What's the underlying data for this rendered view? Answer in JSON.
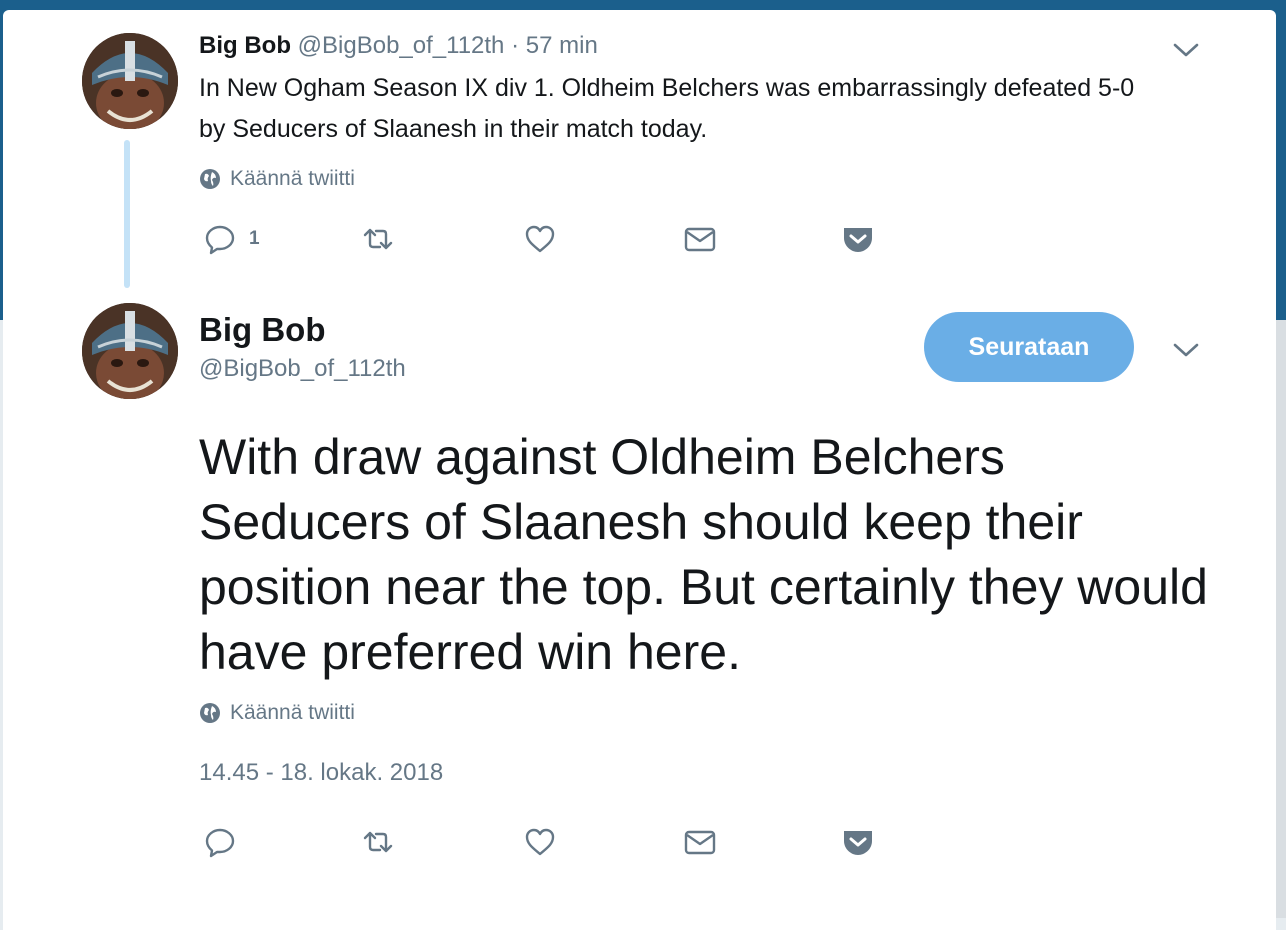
{
  "thread_tweet": {
    "author_name": "Big Bob",
    "author_handle": "@BigBob_of_112th",
    "separator": "·",
    "time": "57 min",
    "text": "In New Ogham Season IX div 1. Oldheim  Belchers was embarrassingly defeated 5-0 by Seducers of Slaanesh in their match today.",
    "translate_label": "Käännä twiitti",
    "reply_count": "1",
    "icons": [
      "reply-icon",
      "retweet-icon",
      "like-icon",
      "message-icon",
      "pocket-icon",
      "chevron-down-icon",
      "globe-icon"
    ]
  },
  "main_tweet": {
    "author_name": "Big Bob",
    "author_handle": "@BigBob_of_112th",
    "follow_label": "Seurataan",
    "text": "With draw against Oldheim  Belchers Seducers of Slaanesh should keep their position near the top. But certainly they would have preferred win here.",
    "translate_label": "Käännä twiitti",
    "timestamp": "14.45 - 18. lokak. 2018",
    "icons": [
      "reply-icon",
      "retweet-icon",
      "like-icon",
      "message-icon",
      "pocket-icon",
      "chevron-down-icon",
      "globe-icon"
    ]
  },
  "colors": {
    "accent": "#6aaee6",
    "thread_line": "#c4e2f7",
    "muted_text": "#657786",
    "text": "#14171a",
    "backdrop": "#1b5f8c"
  }
}
